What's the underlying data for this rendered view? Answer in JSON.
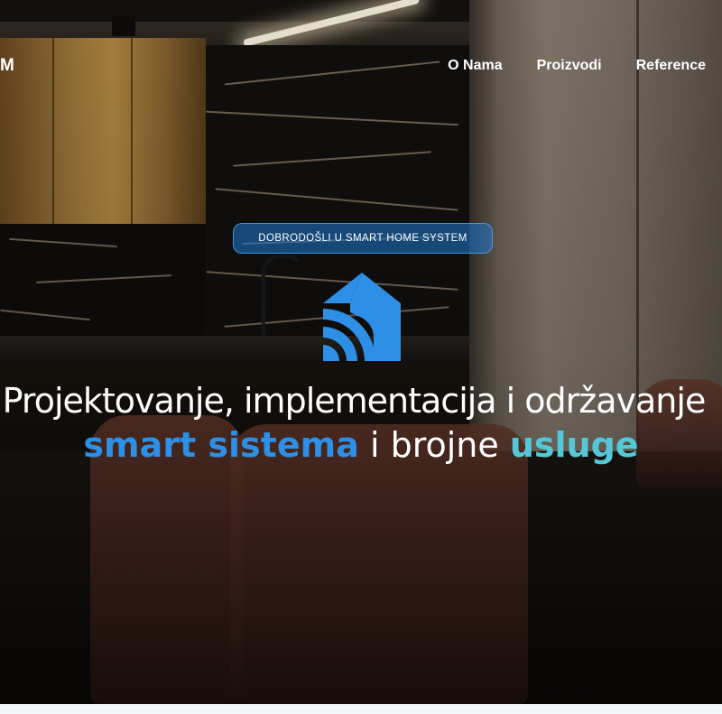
{
  "header": {
    "logo_fragment": "M",
    "nav": [
      {
        "label": "O Nama"
      },
      {
        "label": "Proizvodi"
      },
      {
        "label": "Reference"
      }
    ]
  },
  "hero": {
    "badge": "DOBRODOŠLI U SMART HOME SYSTEM",
    "headline_line1": "Projektovanje, implementacija i održavanje",
    "headline_line2_part1": "smart sistema",
    "headline_line2_part2": " i brojne ",
    "headline_line2_part3": "usluge",
    "icon": "smart-home-wifi-icon"
  },
  "colors": {
    "accent_blue": "#2d8fe6",
    "accent_teal": "#55c8d8",
    "badge_bg": "#1e78d2",
    "text": "#ffffff"
  }
}
